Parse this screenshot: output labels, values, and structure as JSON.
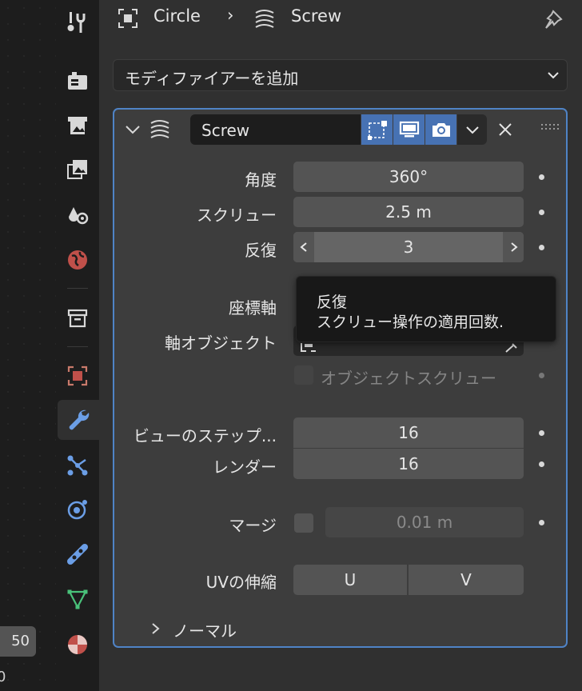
{
  "timeline": {
    "frame_end": "50",
    "frame_other": "0"
  },
  "header": {
    "object_name": "Circle",
    "modifier_name": "Screw"
  },
  "add_modifier": {
    "label": "モディファイアーを追加"
  },
  "modifier": {
    "name": "Screw",
    "fields": {
      "angle_label": "角度",
      "angle_value": "360°",
      "screw_label": "スクリュー",
      "screw_value": "2.5 m",
      "iterations_label": "反復",
      "iterations_value": "3",
      "axis_label": "座標軸",
      "axis_object_label": "軸オブジェクト",
      "object_screw_label": "オブジェクトスクリュー",
      "steps_viewport_label": "ビューのステップ...",
      "steps_viewport_value": "16",
      "steps_render_label": "レンダー",
      "steps_render_value": "16",
      "merge_label": "マージ",
      "merge_value": "0.01 m",
      "uv_stretch_label": "UVの伸縮",
      "uv_u": "U",
      "uv_v": "V",
      "normals_label": "ノーマル"
    }
  },
  "tooltip": {
    "title": "反復",
    "description": "スクリュー操作の適用回数."
  },
  "colors": {
    "accent": "#4f83c6",
    "panel": "#3d3d3d",
    "field": "#545454",
    "bg": "#303030"
  }
}
